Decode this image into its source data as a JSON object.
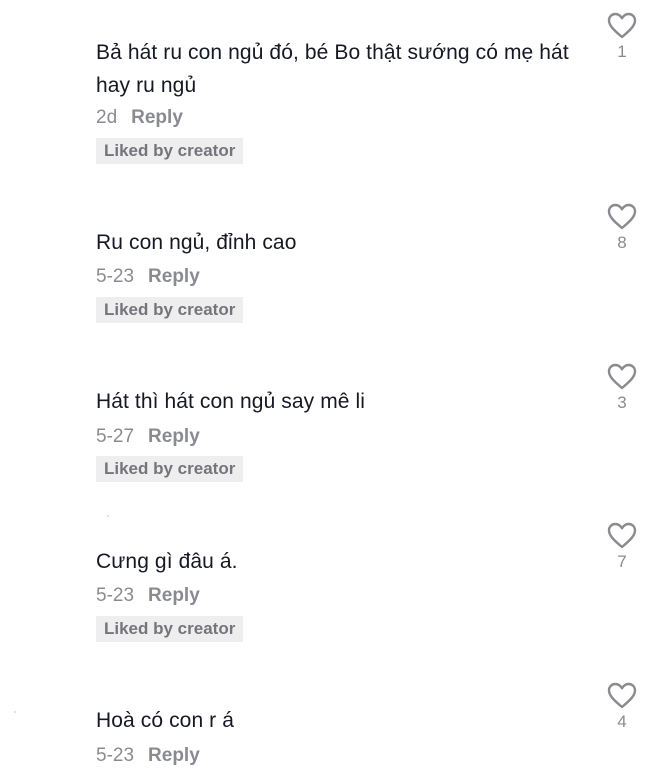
{
  "comments": [
    {
      "text": "Bả hát ru con ngủ đó, bé Bo thật sướng có mẹ hát hay ru ngủ",
      "date": "2d",
      "reply_label": "Reply",
      "badge": "Liked by creator",
      "likes": "1"
    },
    {
      "text": "Ru con ngủ, đỉnh cao",
      "date": "5-23",
      "reply_label": "Reply",
      "badge": "Liked by creator",
      "likes": "8"
    },
    {
      "text": "Hát thì hát con ngủ say mê li",
      "date": "5-27",
      "reply_label": "Reply",
      "badge": "Liked by creator",
      "likes": "3"
    },
    {
      "text": "Cưng gì đâu á.",
      "date": "5-23",
      "reply_label": "Reply",
      "badge": "Liked by creator",
      "likes": "7"
    },
    {
      "text": "Hoà có con r á",
      "date": "5-23",
      "reply_label": "Reply",
      "likes": "4"
    }
  ],
  "icons": {
    "like": "heart-outline-icon"
  },
  "colors": {
    "text": "#161823",
    "meta": "#8a8b91",
    "badge_bg": "#eeeeef",
    "badge_text": "#74757b",
    "heart_stroke": "#8a8b91"
  }
}
